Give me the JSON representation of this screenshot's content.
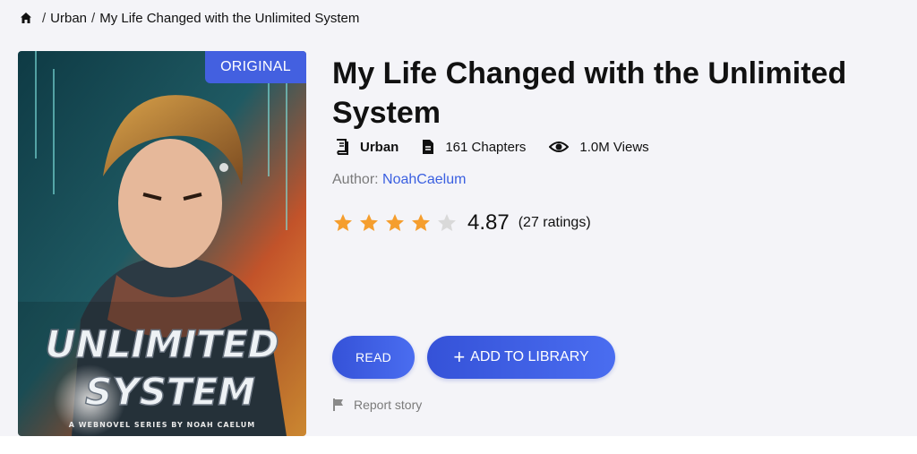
{
  "breadcrumb": {
    "home_icon": "home-icon",
    "category": "Urban",
    "current": "My Life Changed with the Unlimited System"
  },
  "cover": {
    "badge": "ORIGINAL",
    "art_title_line1": "UNLIMITED",
    "art_title_line2": "SYSTEM",
    "art_subtitle": "A WEBNOVEL SERIES BY NOAH CAELUM"
  },
  "book": {
    "title": "My Life Changed with the Unlimited System",
    "genre": "Urban",
    "chapters": "161 Chapters",
    "views": "1.0M Views",
    "author_label": "Author: ",
    "author_name": "NoahCaelum"
  },
  "rating": {
    "score": "4.87",
    "count": "(27 ratings)",
    "stars_filled": 4,
    "stars_total": 5
  },
  "actions": {
    "read_label": "READ",
    "add_label": "ADD TO LIBRARY",
    "report_label": "Report story"
  },
  "colors": {
    "accent": "#4360e0",
    "star": "#f59e2e",
    "star_empty": "#d9d9d9",
    "link": "#3a5fe0"
  }
}
